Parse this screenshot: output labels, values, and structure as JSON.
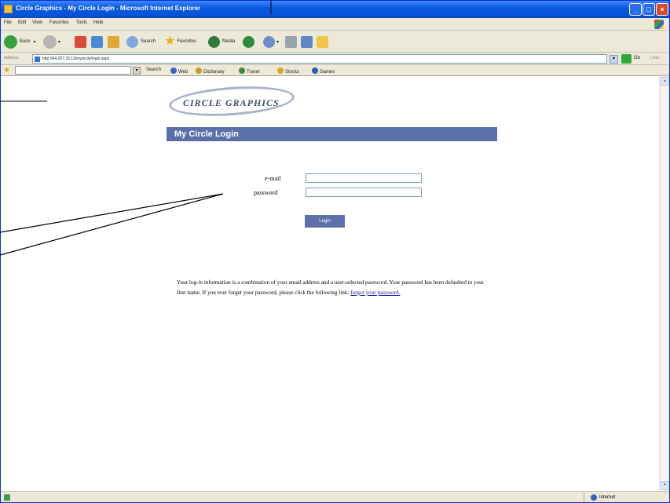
{
  "window": {
    "title": "Circle Graphics - My Circle Login - Microsoft Internet Explorer"
  },
  "menu": [
    "File",
    "Edit",
    "View",
    "Favorites",
    "Tools",
    "Help"
  ],
  "toolbar": {
    "back_label": "Back",
    "search_label": "Search",
    "favorites_label": "Favorites",
    "media_label": "Media"
  },
  "address": {
    "label": "Address",
    "url": "http://64.207.33.13/mycircle/login.aspx",
    "go_label": "Go",
    "links_label": "Links"
  },
  "links_bar": {
    "search_label": "Search",
    "web_label": "Web",
    "dictionary_label": "Dictionary",
    "travel_label": "Travel",
    "stocks_label": "Stocks",
    "games_label": "Games"
  },
  "page": {
    "logo_text": "CIRCLE GRAPHICS",
    "header": "My Circle Login",
    "email_label": "e-mail",
    "password_label": "password",
    "email_value": "",
    "password_value": "",
    "login_button": "Login",
    "info_text": "Your log-in information is a combination of your email address and a user-selected password. Your password has been defaulted to your first name. If you ever forget your password, please click the following link:",
    "forgot_link": "forgot your password."
  },
  "status": {
    "text": "",
    "zone_label": "Internet"
  },
  "colors": {
    "header_bg": "#5b6fa8",
    "titlebar": "#0a58e2"
  }
}
